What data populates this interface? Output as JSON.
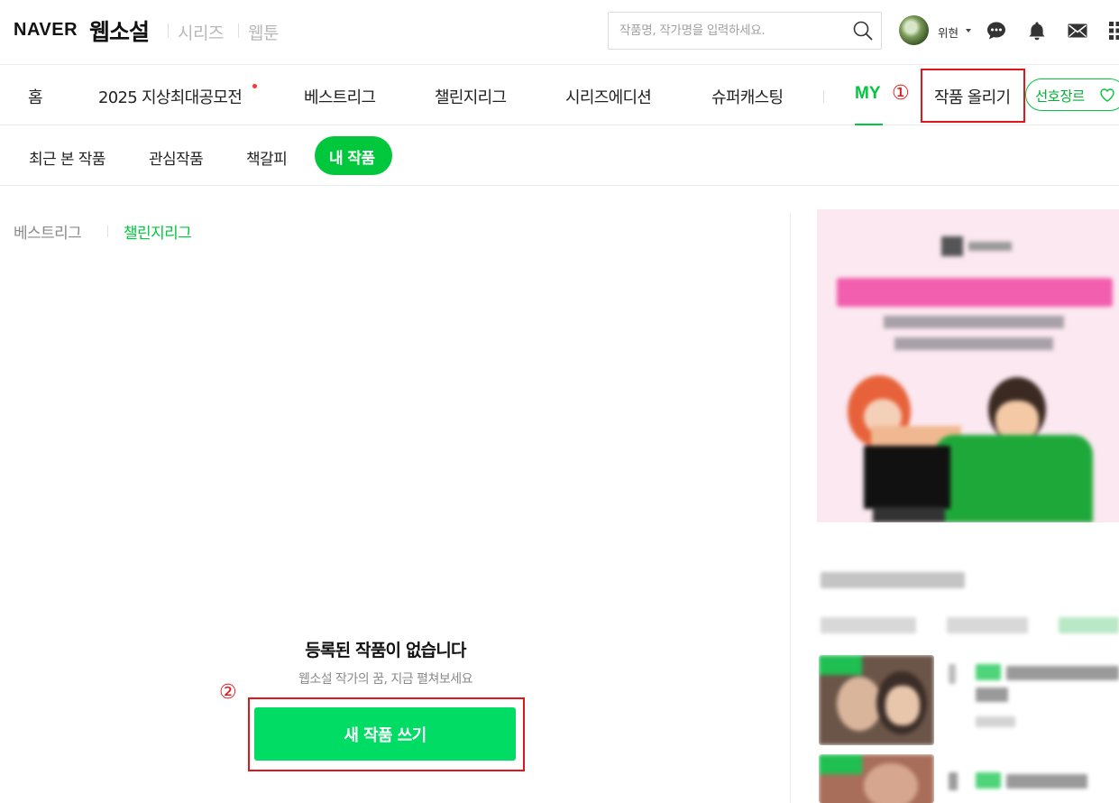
{
  "header": {
    "logo": "NAVER",
    "brand": "웹소설",
    "links": [
      "시리즈",
      "웹툰"
    ],
    "search_placeholder": "작품명, 작가명을 입력하세요.",
    "username": "위현"
  },
  "nav": {
    "items": [
      "홈",
      "2025 지상최대공모전",
      "베스트리그",
      "챌린지리그",
      "시리즈에디션",
      "슈퍼캐스팅"
    ],
    "my": "MY",
    "upload": "작품 올리기",
    "genre": "선호장르",
    "marker1": "①"
  },
  "subnav": {
    "items": [
      "최근 본 작품",
      "관심작품",
      "책갈피"
    ],
    "active": "내 작품"
  },
  "content": {
    "tabs": [
      "베스트리그",
      "챌린지리그"
    ],
    "empty_title": "등록된 작품이 없습니다",
    "empty_desc": "웹소설 작가의 꿈, 지금 펼쳐보세요",
    "new_button": "새 작품 쓰기",
    "marker2": "②"
  },
  "colors": {
    "brand_green": "#00c73c",
    "button_green": "#00dc64",
    "annotation_red": "#e0161b"
  }
}
